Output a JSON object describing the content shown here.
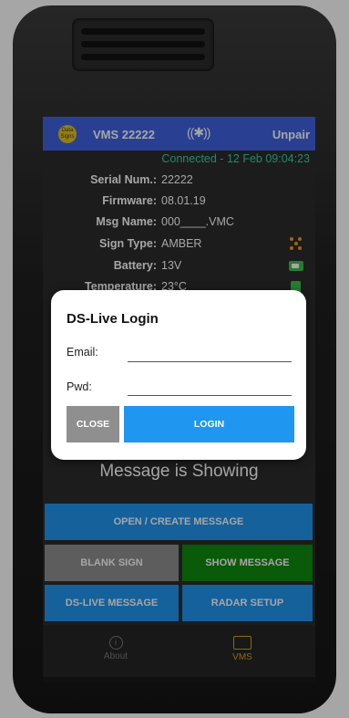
{
  "header": {
    "logo_text": "Data Signs",
    "title": "VMS 22222",
    "bluetooth_icon": "bluetooth-icon",
    "unpair_label": "Unpair"
  },
  "status": "Connected - 12 Feb 09:04:23",
  "info": [
    {
      "label": "Serial Num.:",
      "value": "22222"
    },
    {
      "label": "Firmware:",
      "value": "08.01.19"
    },
    {
      "label": "Msg Name:",
      "value": "000____.VMC"
    },
    {
      "label": "Sign Type:",
      "value": "AMBER"
    },
    {
      "label": "Battery:",
      "value": "13V"
    },
    {
      "label": "Temperature:",
      "value": "23°C"
    }
  ],
  "message_status": "Message is Showing",
  "buttons": {
    "open_create": "OPEN / CREATE MESSAGE",
    "blank_sign": "BLANK SIGN",
    "show_message": "SHOW MESSAGE",
    "ds_live": "DS-LIVE MESSAGE",
    "radar_setup": "RADAR SETUP"
  },
  "nav": {
    "about": "About",
    "vms": "VMS"
  },
  "dialog": {
    "title": "DS-Live Login",
    "email_label": "Email:",
    "email_value": "",
    "pwd_label": "Pwd:",
    "pwd_value": "",
    "close_label": "CLOSE",
    "login_label": "LOGIN"
  },
  "colors": {
    "header": "#3f63e0",
    "status_text": "#39d0a8",
    "primary_button": "#1f96f0",
    "show_button": "#0e8a0e",
    "grey_button": "#8f8f8f",
    "vms_active": "#d8a21a"
  }
}
